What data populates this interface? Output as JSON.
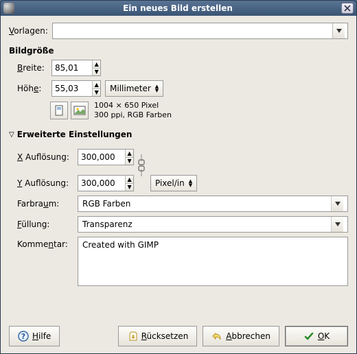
{
  "window": {
    "title": "Ein neues Bild erstellen"
  },
  "templates": {
    "label_pre": "V",
    "label_post": "orlagen:",
    "value": ""
  },
  "image_size": {
    "title": "Bildgröße",
    "width_label_pre": "B",
    "width_label_post": "reite:",
    "height_label": "Höh",
    "height_label_u": "e",
    "height_label_post": ":",
    "width_value": "85,01",
    "height_value": "55,03",
    "unit": "Millimeter",
    "info_line1": "1004 × 650 Pixel",
    "info_line2": "300 ppi, RGB Farben"
  },
  "advanced": {
    "title": "Erweiterte Einstellungen",
    "xres_pre": "X",
    "xres_post": " Auflösung:",
    "yres_pre": "Y",
    "yres_post": " Auflösung:",
    "xres_value": "300,000",
    "yres_value": "300,000",
    "res_unit": "Pixel/in",
    "colorspace_label": "Farbra",
    "colorspace_label_u": "u",
    "colorspace_label_post": "m:",
    "colorspace_value": "RGB Farben",
    "fill_label_u": "F",
    "fill_label_post": "üllung:",
    "fill_value": "Transparenz",
    "comment_label": "Komme",
    "comment_label_u": "n",
    "comment_label_post": "tar:",
    "comment_value": "Created with GIMP"
  },
  "buttons": {
    "help_u": "H",
    "help_post": "ilfe",
    "reset_u": "R",
    "reset_post": "ücksetzen",
    "cancel_u": "A",
    "cancel_post": "bbrechen",
    "ok_u": "O",
    "ok_post": "K"
  }
}
